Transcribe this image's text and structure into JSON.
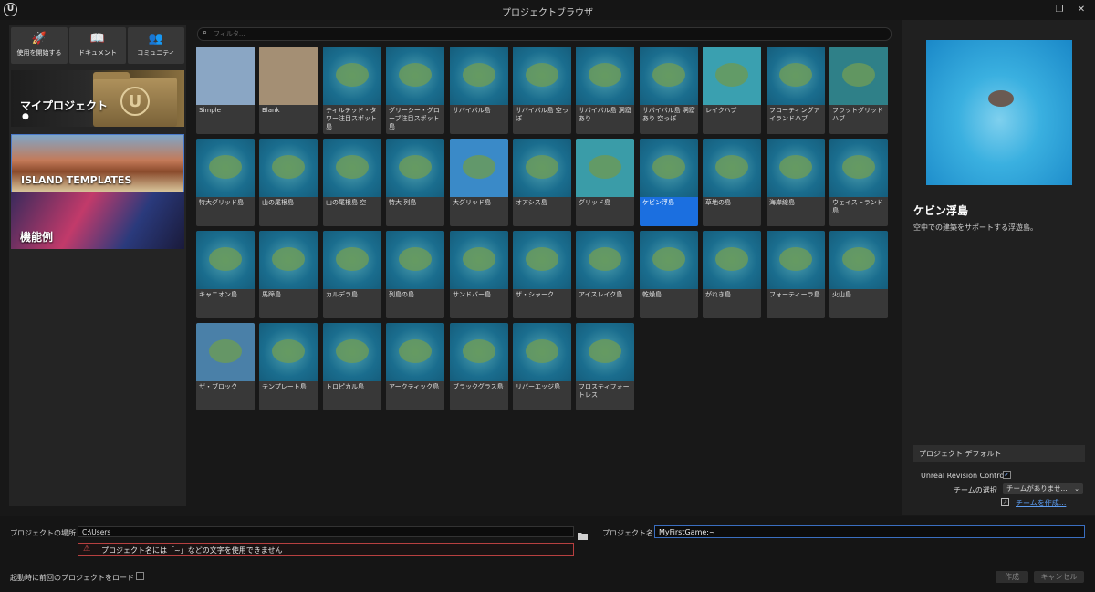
{
  "window": {
    "title": "プロジェクトブラウザ",
    "logo": "U"
  },
  "topbuttons": [
    {
      "label": "使用を開始する",
      "icon": "rocket-icon",
      "glyph": "🚀"
    },
    {
      "label": "ドキュメント",
      "icon": "book-icon",
      "glyph": "📖"
    },
    {
      "label": "コミュニティ",
      "icon": "people-icon",
      "glyph": "👥"
    }
  ],
  "categories": {
    "my_projects": "マイプロジェクト",
    "island_templates": "ISLAND TEMPLATES",
    "feature_examples": "機能例"
  },
  "filter": {
    "placeholder": "フィルタ..."
  },
  "tiles": [
    "Simple",
    "Blank",
    "ティルテッド・タワー注目スポット島",
    "グリーシー・グローブ注目スポット島",
    "サバイバル島",
    "サバイバル島 空っぽ",
    "サバイバル島 洞窟あり",
    "サバイバル島 洞窟あり 空っぽ",
    "レイクハブ",
    "フローティングアイランドハブ",
    "フラットグリッドハブ",
    "特大グリッド島",
    "山の尾根島",
    "山の尾根島 空",
    "特大 列島",
    "大グリッド島",
    "オアシス島",
    "グリッド島",
    "ケビン浮島",
    "草地の島",
    "海岸線島",
    "ウェイストランド島",
    "キャニオン島",
    "馬蹄島",
    "カルデラ島",
    "列島の島",
    "サンドバー島",
    "ザ・シャーク",
    "アイスレイク島",
    "乾燥島",
    "がれき島",
    "フォーティーラ島",
    "火山島",
    "ザ・ブロック",
    "テンプレート島",
    "トロピカル島",
    "アークティック島",
    "ブラックグラス島",
    "リバーエッジ島",
    "フロスティフォートレス"
  ],
  "selected": {
    "title": "ケビン浮島",
    "description": "空中での建築をサポートする浮遊島。"
  },
  "project_defaults": {
    "header": "プロジェクト デフォルト",
    "revision_control_label": "Unreal Revision Control",
    "revision_control_checked": true,
    "team_label": "チームの選択",
    "team_value": "チームがありませ...",
    "create_team_link": "チームを作成..."
  },
  "bottom": {
    "location_label": "プロジェクトの場所",
    "location_value": "C:\\Users",
    "error_text": "プロジェクト名には「~」などの文字を使用できません",
    "name_label": "プロジェクト名",
    "name_value": "MyFirstGame:~",
    "load_last_label": "起動時に前回のプロジェクトをロード",
    "create_button": "作成",
    "cancel_button": "キャンセル"
  }
}
